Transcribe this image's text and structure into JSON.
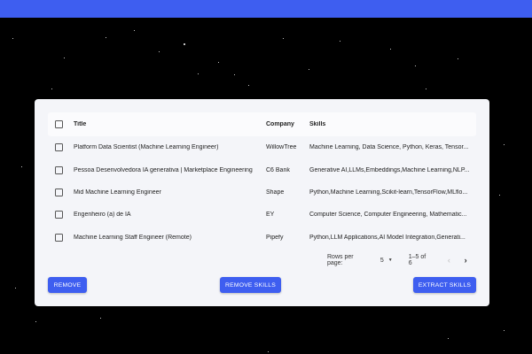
{
  "colors": {
    "accent": "#3e5ef0",
    "background": "#000000",
    "panel": "#f4f5f9"
  },
  "table": {
    "headers": {
      "title": "Title",
      "company": "Company",
      "skills": "Skills"
    },
    "rows": [
      {
        "title": "Platform Data Scientist (Machine Learning Engineer)",
        "company": "WillowTree",
        "skills": "Machine Learning, Data Science, Python, Keras, Tensor..."
      },
      {
        "title": "Pessoa Desenvolvedora IA generativa | Marketplace Engineering",
        "company": "C6 Bank",
        "skills": "Generative AI,LLMs,Embeddings,Machine Learning,NLP..."
      },
      {
        "title": "Mid Machine Learning Engineer",
        "company": "Shape",
        "skills": "Python,Machine Learning,Scikit-learn,TensorFlow,MLflo..."
      },
      {
        "title": "Engenheiro (a) de IA",
        "company": "EY",
        "skills": "Computer Science, Computer Engineering, Mathematic..."
      },
      {
        "title": "Machine Learning Staff Engineer (Remote)",
        "company": "Pipefy",
        "skills": "Python,LLM Applications,AI Model Integration,Generati..."
      }
    ]
  },
  "pagination": {
    "rows_per_page_label": "Rows per page:",
    "rows_per_page_value": "5",
    "range_label": "1–5 of 6",
    "prev_icon": "chevron-left-icon",
    "next_icon": "chevron-right-icon"
  },
  "buttons": {
    "remove": "REMOVE",
    "remove_skills": "REMOVE SKILLS",
    "extract_skills": "EXTRACT SKILLS"
  }
}
